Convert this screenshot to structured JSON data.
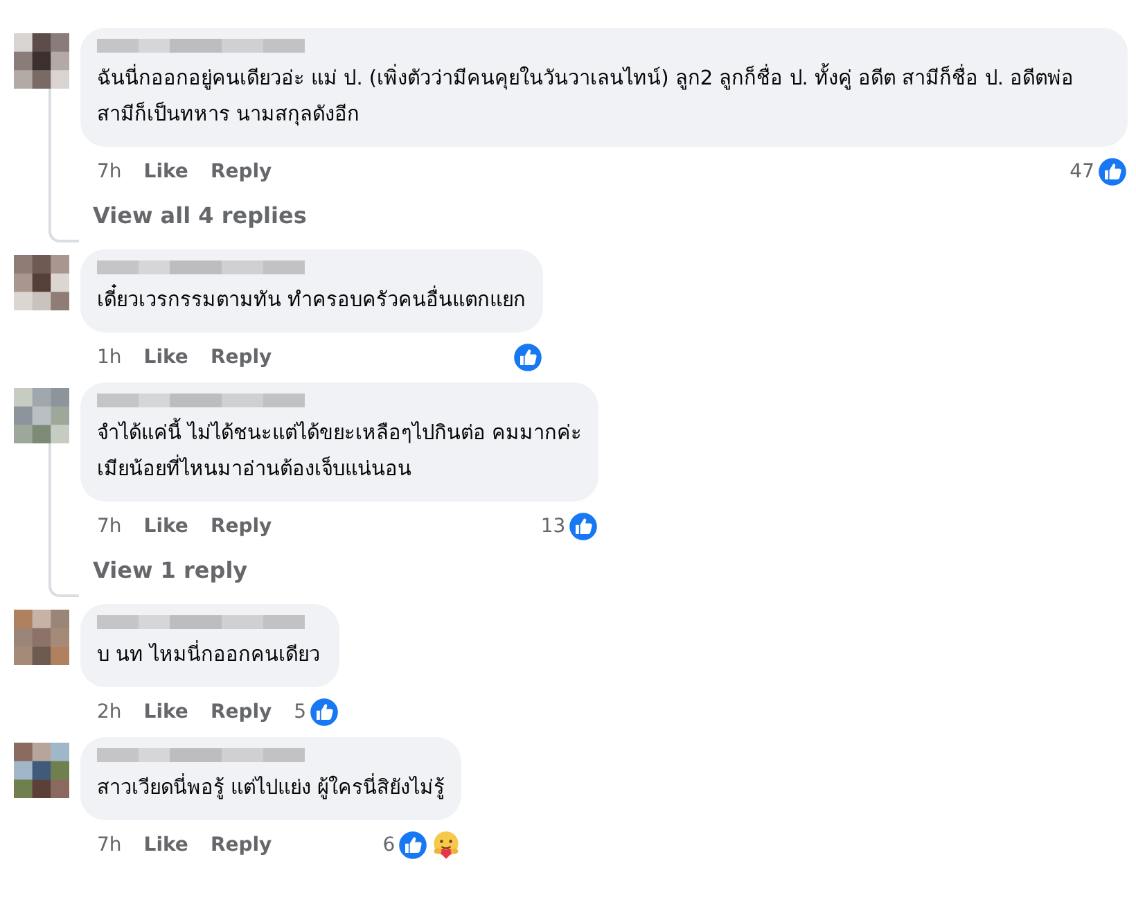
{
  "comments": [
    {
      "author_hidden": true,
      "text": "ฉันนี่กออกอยู่คนเดียวอ่ะ แม่ ป. (เพิ่งตัวว่ามีคนคุยในวันวาเลนไทน์) ลูก2 ลูกก็ชื่อ ป. ทั้งคู่ อดีต สามีก็ชื่อ ป. อดีตพ่อสามีก็เป็นทหาร นามสกุลดังอีก",
      "time": "7h",
      "like": "Like",
      "reply": "Reply",
      "reaction_count": "47",
      "reactions": [
        {
          "kind": "like"
        }
      ],
      "view_replies": "View all 4 replies"
    },
    {
      "author_hidden": true,
      "text": "เดี๋ยวเวรกรรมตามทัน ทำครอบครัวคนอื่นแตกแยก",
      "time": "1h",
      "like": "Like",
      "reply": "Reply",
      "reactions": [
        {
          "kind": "like"
        }
      ]
    },
    {
      "author_hidden": true,
      "text": "จำได้แค่นี้ ไม่ได้ชนะแต่ได้ขยะเหลือๆไปกินต่อ คมมากค่ะ\nเมียน้อยที่ไหนมาอ่านต้องเจ็บแน่นอน",
      "time": "7h",
      "like": "Like",
      "reply": "Reply",
      "reaction_count": "13",
      "reactions": [
        {
          "kind": "like"
        }
      ],
      "view_replies": "View 1 reply"
    },
    {
      "author_hidden": true,
      "text": "บ นท ไหมนี่กออกคนเดียว",
      "time": "2h",
      "like": "Like",
      "reply": "Reply",
      "reaction_count": "5",
      "reactions": [
        {
          "kind": "like"
        }
      ]
    },
    {
      "author_hidden": true,
      "text": "สาวเวียดนี่พอรู้ แต่ไปแย่ง ผู้ใครนี่สิยังไม่รู้",
      "time": "7h",
      "like": "Like",
      "reply": "Reply",
      "reaction_count": "6",
      "reactions": [
        {
          "kind": "like"
        },
        {
          "kind": "care"
        }
      ]
    }
  ]
}
